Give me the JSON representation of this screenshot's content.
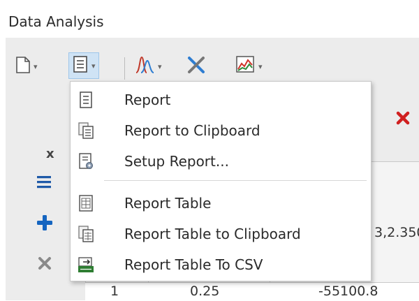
{
  "window": {
    "title": "Data Analysis"
  },
  "toolbar": {
    "items": [
      {
        "icon": "new-document-icon"
      },
      {
        "icon": "report-icon",
        "active": true
      },
      {
        "icon": "peak-fit-icon"
      },
      {
        "icon": "tools-icon"
      },
      {
        "icon": "chart-icon"
      }
    ]
  },
  "report_menu": {
    "items": [
      {
        "label": "Report",
        "icon": "report-icon"
      },
      {
        "label": "Report to Clipboard",
        "icon": "report-clipboard-icon"
      },
      {
        "label": "Setup Report...",
        "icon": "setup-report-icon"
      },
      {
        "label": "Report Table",
        "icon": "report-table-icon"
      },
      {
        "label": "Report Table to Clipboard",
        "icon": "report-table-clipboard-icon"
      },
      {
        "label": "Report Table To CSV",
        "icon": "csv-icon"
      }
    ]
  },
  "grid": {
    "column_label": "x",
    "partial_value": "3,2.350",
    "row_index": "1",
    "row_x": "0.25",
    "row_y": "-55100.8"
  },
  "colors": {
    "accent_red": "#d01f1f",
    "accent_blue": "#1565c0",
    "active_bg": "#cfe3f5"
  }
}
